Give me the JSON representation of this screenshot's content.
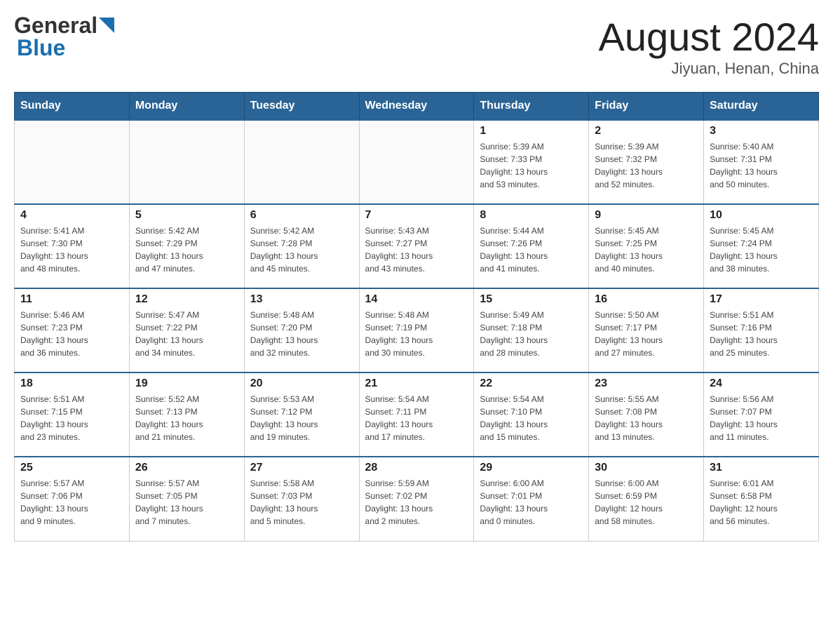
{
  "header": {
    "logo": {
      "general": "General",
      "blue": "Blue"
    },
    "title": "August 2024",
    "location": "Jiyuan, Henan, China"
  },
  "calendar": {
    "days_of_week": [
      "Sunday",
      "Monday",
      "Tuesday",
      "Wednesday",
      "Thursday",
      "Friday",
      "Saturday"
    ],
    "weeks": [
      {
        "days": [
          {
            "num": "",
            "info": ""
          },
          {
            "num": "",
            "info": ""
          },
          {
            "num": "",
            "info": ""
          },
          {
            "num": "",
            "info": ""
          },
          {
            "num": "1",
            "info": "Sunrise: 5:39 AM\nSunset: 7:33 PM\nDaylight: 13 hours\nand 53 minutes."
          },
          {
            "num": "2",
            "info": "Sunrise: 5:39 AM\nSunset: 7:32 PM\nDaylight: 13 hours\nand 52 minutes."
          },
          {
            "num": "3",
            "info": "Sunrise: 5:40 AM\nSunset: 7:31 PM\nDaylight: 13 hours\nand 50 minutes."
          }
        ]
      },
      {
        "days": [
          {
            "num": "4",
            "info": "Sunrise: 5:41 AM\nSunset: 7:30 PM\nDaylight: 13 hours\nand 48 minutes."
          },
          {
            "num": "5",
            "info": "Sunrise: 5:42 AM\nSunset: 7:29 PM\nDaylight: 13 hours\nand 47 minutes."
          },
          {
            "num": "6",
            "info": "Sunrise: 5:42 AM\nSunset: 7:28 PM\nDaylight: 13 hours\nand 45 minutes."
          },
          {
            "num": "7",
            "info": "Sunrise: 5:43 AM\nSunset: 7:27 PM\nDaylight: 13 hours\nand 43 minutes."
          },
          {
            "num": "8",
            "info": "Sunrise: 5:44 AM\nSunset: 7:26 PM\nDaylight: 13 hours\nand 41 minutes."
          },
          {
            "num": "9",
            "info": "Sunrise: 5:45 AM\nSunset: 7:25 PM\nDaylight: 13 hours\nand 40 minutes."
          },
          {
            "num": "10",
            "info": "Sunrise: 5:45 AM\nSunset: 7:24 PM\nDaylight: 13 hours\nand 38 minutes."
          }
        ]
      },
      {
        "days": [
          {
            "num": "11",
            "info": "Sunrise: 5:46 AM\nSunset: 7:23 PM\nDaylight: 13 hours\nand 36 minutes."
          },
          {
            "num": "12",
            "info": "Sunrise: 5:47 AM\nSunset: 7:22 PM\nDaylight: 13 hours\nand 34 minutes."
          },
          {
            "num": "13",
            "info": "Sunrise: 5:48 AM\nSunset: 7:20 PM\nDaylight: 13 hours\nand 32 minutes."
          },
          {
            "num": "14",
            "info": "Sunrise: 5:48 AM\nSunset: 7:19 PM\nDaylight: 13 hours\nand 30 minutes."
          },
          {
            "num": "15",
            "info": "Sunrise: 5:49 AM\nSunset: 7:18 PM\nDaylight: 13 hours\nand 28 minutes."
          },
          {
            "num": "16",
            "info": "Sunrise: 5:50 AM\nSunset: 7:17 PM\nDaylight: 13 hours\nand 27 minutes."
          },
          {
            "num": "17",
            "info": "Sunrise: 5:51 AM\nSunset: 7:16 PM\nDaylight: 13 hours\nand 25 minutes."
          }
        ]
      },
      {
        "days": [
          {
            "num": "18",
            "info": "Sunrise: 5:51 AM\nSunset: 7:15 PM\nDaylight: 13 hours\nand 23 minutes."
          },
          {
            "num": "19",
            "info": "Sunrise: 5:52 AM\nSunset: 7:13 PM\nDaylight: 13 hours\nand 21 minutes."
          },
          {
            "num": "20",
            "info": "Sunrise: 5:53 AM\nSunset: 7:12 PM\nDaylight: 13 hours\nand 19 minutes."
          },
          {
            "num": "21",
            "info": "Sunrise: 5:54 AM\nSunset: 7:11 PM\nDaylight: 13 hours\nand 17 minutes."
          },
          {
            "num": "22",
            "info": "Sunrise: 5:54 AM\nSunset: 7:10 PM\nDaylight: 13 hours\nand 15 minutes."
          },
          {
            "num": "23",
            "info": "Sunrise: 5:55 AM\nSunset: 7:08 PM\nDaylight: 13 hours\nand 13 minutes."
          },
          {
            "num": "24",
            "info": "Sunrise: 5:56 AM\nSunset: 7:07 PM\nDaylight: 13 hours\nand 11 minutes."
          }
        ]
      },
      {
        "days": [
          {
            "num": "25",
            "info": "Sunrise: 5:57 AM\nSunset: 7:06 PM\nDaylight: 13 hours\nand 9 minutes."
          },
          {
            "num": "26",
            "info": "Sunrise: 5:57 AM\nSunset: 7:05 PM\nDaylight: 13 hours\nand 7 minutes."
          },
          {
            "num": "27",
            "info": "Sunrise: 5:58 AM\nSunset: 7:03 PM\nDaylight: 13 hours\nand 5 minutes."
          },
          {
            "num": "28",
            "info": "Sunrise: 5:59 AM\nSunset: 7:02 PM\nDaylight: 13 hours\nand 2 minutes."
          },
          {
            "num": "29",
            "info": "Sunrise: 6:00 AM\nSunset: 7:01 PM\nDaylight: 13 hours\nand 0 minutes."
          },
          {
            "num": "30",
            "info": "Sunrise: 6:00 AM\nSunset: 6:59 PM\nDaylight: 12 hours\nand 58 minutes."
          },
          {
            "num": "31",
            "info": "Sunrise: 6:01 AM\nSunset: 6:58 PM\nDaylight: 12 hours\nand 56 minutes."
          }
        ]
      }
    ]
  }
}
